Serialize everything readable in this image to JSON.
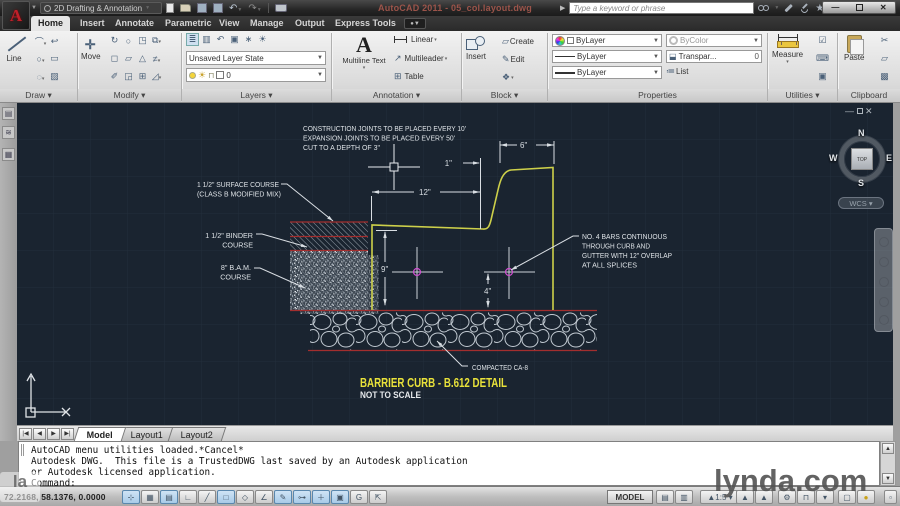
{
  "title_bar": {
    "workspace": "2D Drafting & Annotation",
    "app_title": "AutoCAD 2011 - 05_col.layout.dwg",
    "search_placeholder": "Type a keyword or phrase"
  },
  "ribbon_tabs": [
    "Home",
    "Insert",
    "Annotate",
    "Parametric",
    "View",
    "Manage",
    "Output",
    "Express Tools"
  ],
  "ribbon": {
    "draw": {
      "label": "Draw",
      "line": "Line"
    },
    "modify": {
      "label": "Modify",
      "move": "Move"
    },
    "layers": {
      "label": "Layers",
      "state": "Unsaved Layer State",
      "layer": "0"
    },
    "annotation": {
      "label": "Annotation",
      "mtext": "Multiline Text",
      "linear": "Linear",
      "multileader": "Multileader",
      "table": "Table"
    },
    "block": {
      "label": "Block",
      "insert": "Insert",
      "create": "Create",
      "edit": "Edit"
    },
    "properties": {
      "label": "Properties",
      "bylayer_color": "ByLayer",
      "bycolor": "ByColor",
      "bylayer_linetype": "ByLayer",
      "bylayer_lineweight": "ByLayer",
      "transparency": "Transpar...",
      "transparency_value": "0",
      "list": "List"
    },
    "utilities": {
      "label": "Utilities",
      "measure": "Measure"
    },
    "clipboard": {
      "label": "Clipboard",
      "paste": "Paste"
    }
  },
  "drawing": {
    "notes": {
      "construction": [
        "CONSTRUCTION JOINTS TO BE PLACED EVERY 10'",
        "EXPANSION JOINTS TO BE PLACED EVERY 50'",
        "CUT TO A DEPTH OF 3\""
      ],
      "surface": [
        "1 1/2\" SURFACE COURSE",
        "(CLASS B MODIFIED MIX)"
      ],
      "binder": [
        "1 1/2\" BINDER",
        "COURSE"
      ],
      "bam": [
        "8\" B.A.M.",
        "COURSE"
      ],
      "compacted": "COMPACTED CA-8",
      "bars": [
        "NO. 4 BARS CONTINUOUS",
        "THROUGH CURB AND",
        "GUTTER WITH 12\" OVERLAP",
        "AT ALL SPLICES"
      ]
    },
    "dims": {
      "d6": "6\"",
      "d1": "1\"",
      "d12": "12\"",
      "d9": "9\"",
      "d4": "4\""
    },
    "title": "BARRIER CURB - B.612 DETAIL",
    "subtitle": "NOT TO SCALE",
    "viewcube": {
      "n": "N",
      "s": "S",
      "e": "E",
      "w": "W",
      "top": "TOP",
      "wcs": "WCS"
    }
  },
  "layout_tabs": [
    "Model",
    "Layout1",
    "Layout2"
  ],
  "command": {
    "lines": [
      "AutoCAD menu utilities loaded.*Cancel*",
      "Autodesk DWG.  This file is a TrustedDWG last saved by an Autodesk application",
      "or Autodesk licensed application.",
      "Command:"
    ]
  },
  "status_bar": {
    "coords": "72.2168, 58.1376, 0.0000",
    "model": "MODEL",
    "scale": "1:5"
  },
  "watermark": {
    "big": "lynda.com",
    "small": "la"
  }
}
